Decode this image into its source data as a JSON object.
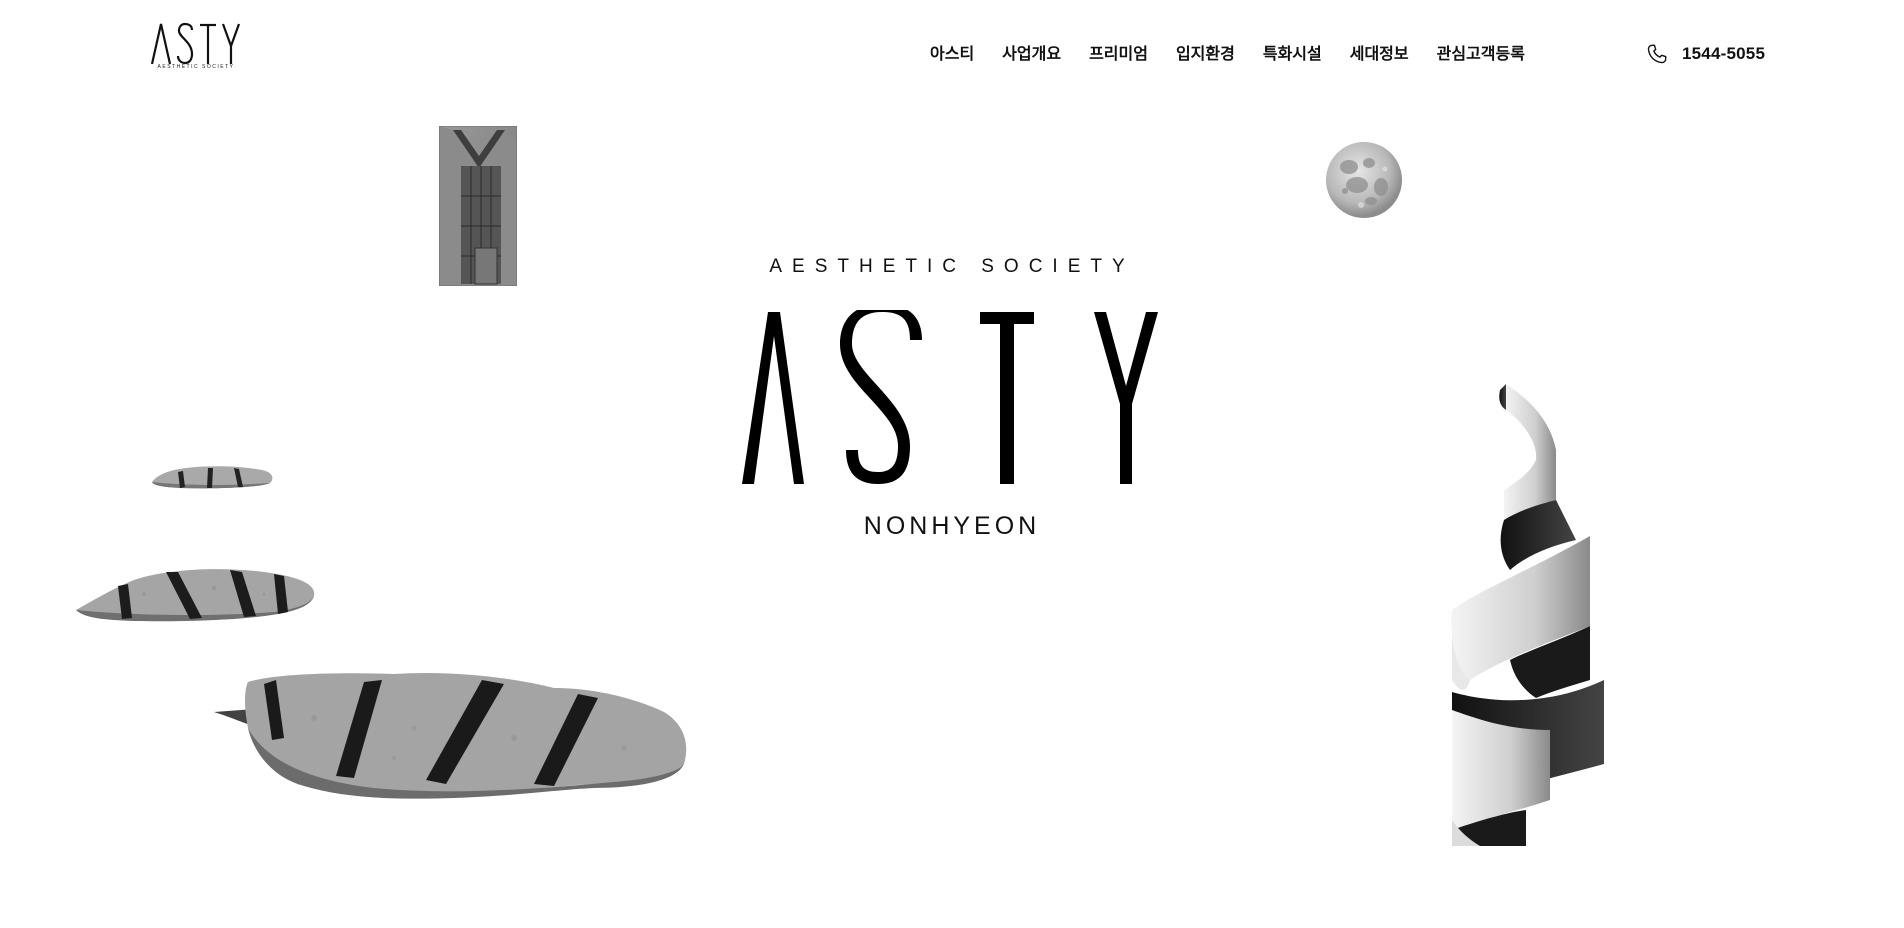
{
  "header": {
    "logo": {
      "wordmark": "ASTY",
      "tagline": "AESTHETIC SOCIETY"
    },
    "nav": [
      {
        "label": "아스티"
      },
      {
        "label": "사업개요"
      },
      {
        "label": "프리미엄"
      },
      {
        "label": "입지환경"
      },
      {
        "label": "특화시설"
      },
      {
        "label": "세대정보"
      },
      {
        "label": "관심고객등록"
      }
    ],
    "phone": {
      "icon": "phone-icon",
      "number": "1544-5055"
    }
  },
  "hero": {
    "subtitle": "AESTHETIC SOCIETY",
    "title": "ASTY",
    "location": "NONHYEON"
  },
  "decorations": {
    "items": [
      "building-image",
      "moon-image",
      "stone-small-image",
      "stone-medium-image",
      "stone-large-image",
      "spiral-ribbon-image"
    ]
  },
  "colors": {
    "text": "#111111",
    "background": "#ffffff"
  }
}
